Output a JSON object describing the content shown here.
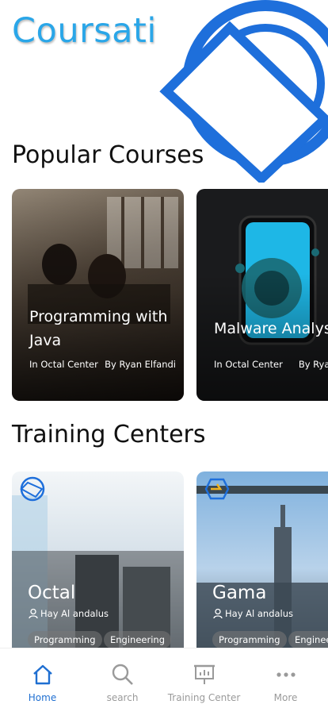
{
  "app": {
    "title": "Coursati"
  },
  "sections": {
    "popular": "Popular Courses",
    "centers": "Training Centers"
  },
  "courses": [
    {
      "title": "Programming with Java",
      "center": "In Octal Center",
      "author": "By Ryan Elfandi"
    },
    {
      "title": "Malware Analysis",
      "center": "In Octal Center",
      "author": "By Ryan Elfandi"
    }
  ],
  "training_centers": [
    {
      "name": "Octal",
      "location": "Hay Al andalus",
      "tags": [
        "Programming",
        "Engineering"
      ]
    },
    {
      "name": "Gama",
      "location": "Hay Al andalus",
      "tags": [
        "Programming",
        "Engineering"
      ]
    }
  ],
  "tabs": [
    {
      "label": "Home",
      "icon": "home-icon",
      "active": true
    },
    {
      "label": "search",
      "icon": "search-icon",
      "active": false
    },
    {
      "label": "Training Center",
      "icon": "presentation-board-icon",
      "active": false
    },
    {
      "label": "More",
      "icon": "more-dots-icon",
      "active": false
    }
  ],
  "colors": {
    "brand": "#2aa6e8",
    "accent": "#1f6fd1",
    "tab_inactive": "#9a9a9a"
  }
}
